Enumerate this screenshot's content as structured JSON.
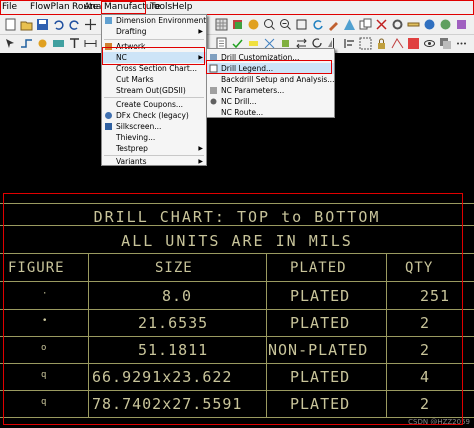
{
  "menubar": {
    "items": [
      {
        "label": "File"
      },
      {
        "label": "FlowPlan"
      },
      {
        "label": "Route"
      },
      {
        "label": "Analyze"
      },
      {
        "label": "Manufacture"
      },
      {
        "label": "Tools"
      },
      {
        "label": "Help"
      }
    ]
  },
  "manufacture_menu": {
    "items": [
      {
        "label": "Dimension Environment"
      },
      {
        "label": "Drafting"
      },
      {
        "label": "Artwork"
      },
      {
        "label": "NC"
      },
      {
        "label": "Cross Section Chart..."
      },
      {
        "label": "Cut Marks"
      },
      {
        "label": "Stream Out(GDSII)"
      },
      {
        "label": "Create Coupons..."
      },
      {
        "label": "DFx Check (legacy)"
      },
      {
        "label": "Silkscreen..."
      },
      {
        "label": "Thieving..."
      },
      {
        "label": "Testprep"
      },
      {
        "label": "Variants"
      }
    ]
  },
  "nc_submenu": {
    "items": [
      {
        "label": "Drill Customization..."
      },
      {
        "label": "Drill Legend..."
      },
      {
        "label": "Backdrill Setup and Analysis..."
      },
      {
        "label": "NC Parameters..."
      },
      {
        "label": "NC Drill..."
      },
      {
        "label": "NC Route..."
      }
    ]
  },
  "drill_chart": {
    "title_line1": "DRILL CHART: TOP to BOTTOM",
    "title_line2": "ALL UNITS ARE IN MILS",
    "headers": {
      "figure": "FIGURE",
      "size": "SIZE",
      "plated": "PLATED",
      "qty": "QTY"
    },
    "rows": [
      {
        "figure": "·",
        "size": "8.0",
        "plated": "PLATED",
        "qty": "251"
      },
      {
        "figure": "•",
        "size": "21.6535",
        "plated": "PLATED",
        "qty": "2"
      },
      {
        "figure": "o",
        "size": "51.1811",
        "plated": "NON-PLATED",
        "qty": "2"
      },
      {
        "figure": "q",
        "size": "66.9291x23.622",
        "plated": "PLATED",
        "qty": "4"
      },
      {
        "figure": "q",
        "size": "78.7402x27.5591",
        "plated": "PLATED",
        "qty": "2"
      }
    ]
  },
  "watermark": "CSDN @HZZ2059",
  "colors": {
    "highlight_box": "#e00000",
    "chart_text": "#c8c49a",
    "chart_grid": "#9a9a60",
    "canvas_bg": "#000000",
    "menu_highlight": "#cde4f7"
  }
}
